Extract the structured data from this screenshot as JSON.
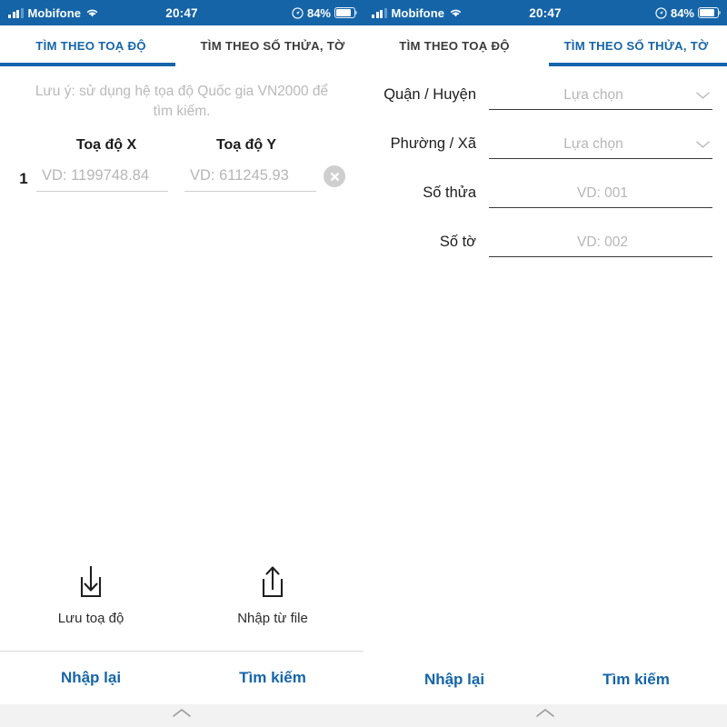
{
  "statusbar": {
    "carrier": "Mobifone",
    "time": "20:47",
    "battery_percent": "84%",
    "signal_icon": "signal-bars-icon",
    "wifi_icon": "wifi-icon",
    "location_icon": "location-services-icon",
    "battery_icon": "battery-icon"
  },
  "theme": {
    "accent": "#1565a9",
    "statusbar_bg": "#1564a8",
    "placeholder": "#b6b6b6",
    "text": "#1c1c1c"
  },
  "left_panel": {
    "tabs": [
      {
        "label": "TÌM THEO TOẠ ĐỘ",
        "active": true
      },
      {
        "label": "TÌM THEO SỐ THỬA, TỜ",
        "active": false
      }
    ],
    "note": "Lưu ý: sử dụng hệ tọa độ Quốc gia VN2000 để tìm kiếm.",
    "columns": [
      "Toạ độ X",
      "Toạ độ Y"
    ],
    "rows": [
      {
        "index": "1",
        "x_value": "",
        "x_placeholder": "VD: 1199748.84",
        "y_value": "",
        "y_placeholder": "VD: 611245.93",
        "clear_icon": "clear-circle-x-icon"
      }
    ],
    "actions": [
      {
        "label": "Lưu toạ độ",
        "icon": "download-save-icon"
      },
      {
        "label": "Nhập từ file",
        "icon": "upload-import-icon"
      }
    ],
    "bottom_buttons": [
      "Nhập lại",
      "Tìm kiếm"
    ]
  },
  "right_panel": {
    "tabs": [
      {
        "label": "TÌM THEO TOẠ ĐỘ",
        "active": false
      },
      {
        "label": "TÌM THEO SỐ THỬA, TỜ",
        "active": true
      }
    ],
    "fields": [
      {
        "label": "Quận / Huyện",
        "value": "",
        "placeholder": "Lựa chọn",
        "type": "select",
        "icon": "chevron-down-icon"
      },
      {
        "label": "Phường / Xã",
        "value": "",
        "placeholder": "Lựa chọn",
        "type": "select",
        "icon": "chevron-down-icon"
      },
      {
        "label": "Số thửa",
        "value": "",
        "placeholder": "VD: 001",
        "type": "text"
      },
      {
        "label": "Số tờ",
        "value": "",
        "placeholder": "VD: 002",
        "type": "text"
      }
    ],
    "bottom_buttons": [
      "Nhập lại",
      "Tìm kiếm"
    ]
  }
}
